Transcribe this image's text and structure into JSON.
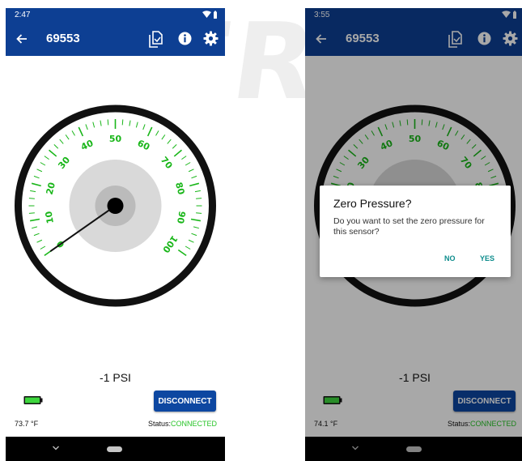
{
  "colors": {
    "primary": "#0d3f93",
    "button": "#0d47a1",
    "gauge_green": "#19b619",
    "connected": "#27c427",
    "dialog_action": "#0d8c8c"
  },
  "icons": {
    "back": "arrow-back-icon",
    "copy": "copy-icon",
    "info": "info-icon",
    "settings": "gear-icon",
    "battery": "battery-icon",
    "wifi": "wifi-icon"
  },
  "screens": [
    {
      "status_time": "2:47",
      "toolbar_title": "69553",
      "gauge": {
        "labels": [
          "0",
          "10",
          "20",
          "30",
          "40",
          "50",
          "60",
          "70",
          "80",
          "90",
          "100"
        ],
        "reading": 0
      },
      "pressure": "-1 PSI",
      "battery_level": 1.0,
      "disconnect_label": "DISCONNECT",
      "temperature": "73.7 °F",
      "status_label": "Status:",
      "status_value": "CONNECTED"
    },
    {
      "status_time": "3:55",
      "toolbar_title": "69553",
      "gauge": {
        "labels": [
          "0",
          "10",
          "20",
          "30",
          "40",
          "50",
          "60",
          "70",
          "80",
          "90",
          "100"
        ]
      },
      "pressure": "-1 PSI",
      "battery_level": 1.0,
      "disconnect_label": "DISCONNECT",
      "temperature": "74.1 °F",
      "status_label": "Status:",
      "status_value": "CONNECTED",
      "dialog": {
        "title": "Zero Pressure?",
        "message": "Do you want to set the zero pressure for this sensor?",
        "no_label": "NO",
        "yes_label": "YES"
      }
    }
  ]
}
